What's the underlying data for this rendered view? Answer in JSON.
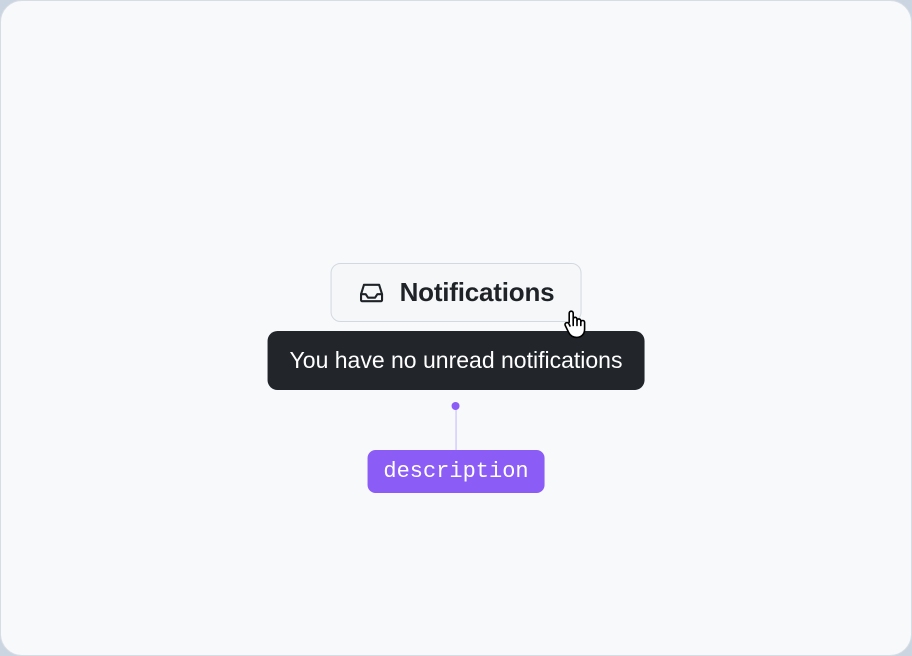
{
  "button": {
    "label": "Notifications"
  },
  "tooltip": {
    "text": "You have no unread notifications"
  },
  "annotation": {
    "tag": "description"
  }
}
